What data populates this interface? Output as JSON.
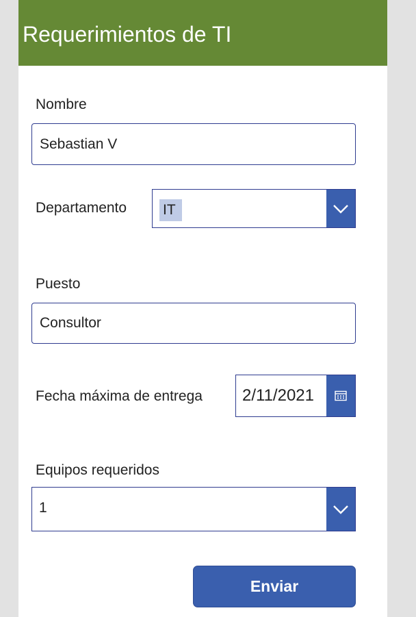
{
  "header": {
    "title": "Requerimientos de TI"
  },
  "form": {
    "nombre": {
      "label": "Nombre",
      "value": "Sebastian V"
    },
    "departamento": {
      "label": "Departamento",
      "value": "IT"
    },
    "puesto": {
      "label": "Puesto",
      "value": "Consultor"
    },
    "fecha_entrega": {
      "label": "Fecha máxima de entrega",
      "value": "2/11/2021"
    },
    "equipos": {
      "label": "Equipos requeridos",
      "value": "1"
    },
    "submit_label": "Enviar"
  },
  "colors": {
    "header_bg": "#658935",
    "accent": "#3a5fae",
    "border": "#2e3b8f",
    "selection_highlight": "#bfcbe6"
  },
  "icons": {
    "dropdown": "chevron-down-icon",
    "calendar": "calendar-icon"
  }
}
